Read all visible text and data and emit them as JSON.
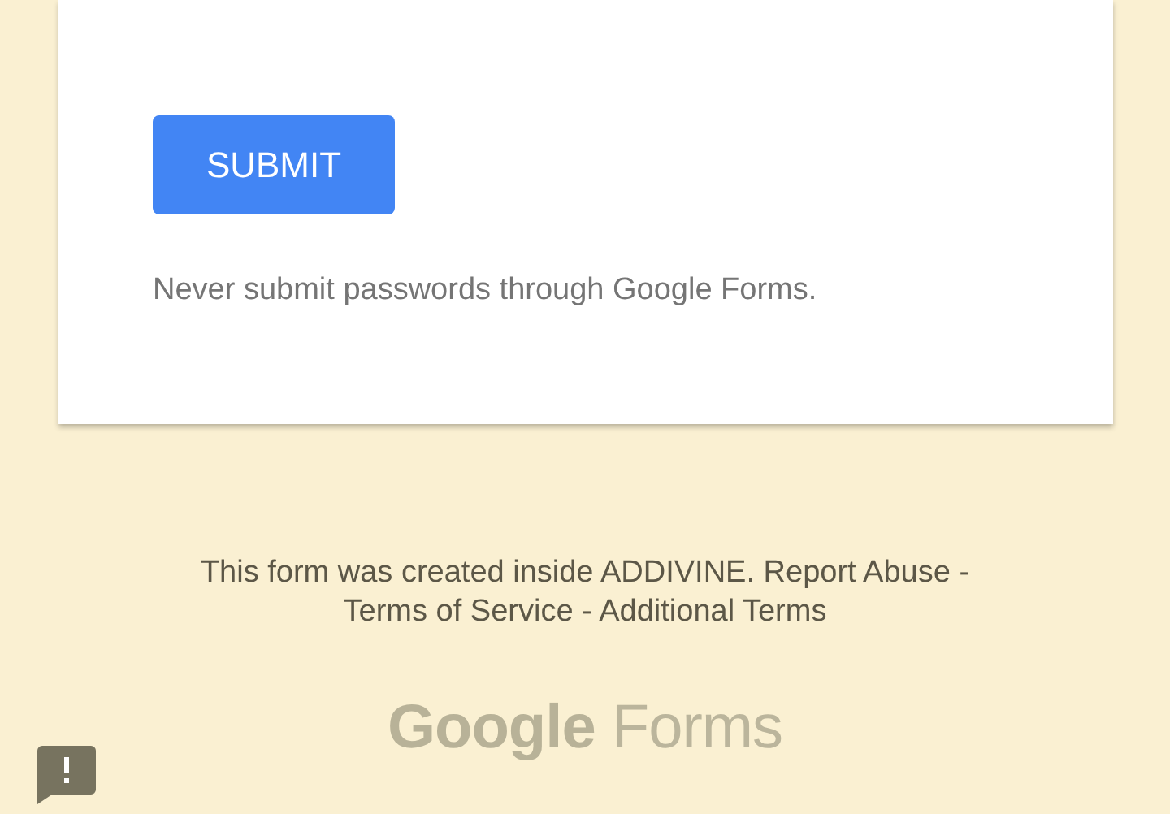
{
  "form_card": {
    "submit_button": "SUBMIT",
    "notice": "Never submit passwords through Google Forms."
  },
  "footer": {
    "text": "This form was created inside ADDIVINE.",
    "links": [
      "Report Abuse",
      "Terms of Service",
      "Additional Terms"
    ],
    "separator": "-"
  },
  "logo": {
    "brand": "Google",
    "product": "Forms"
  }
}
